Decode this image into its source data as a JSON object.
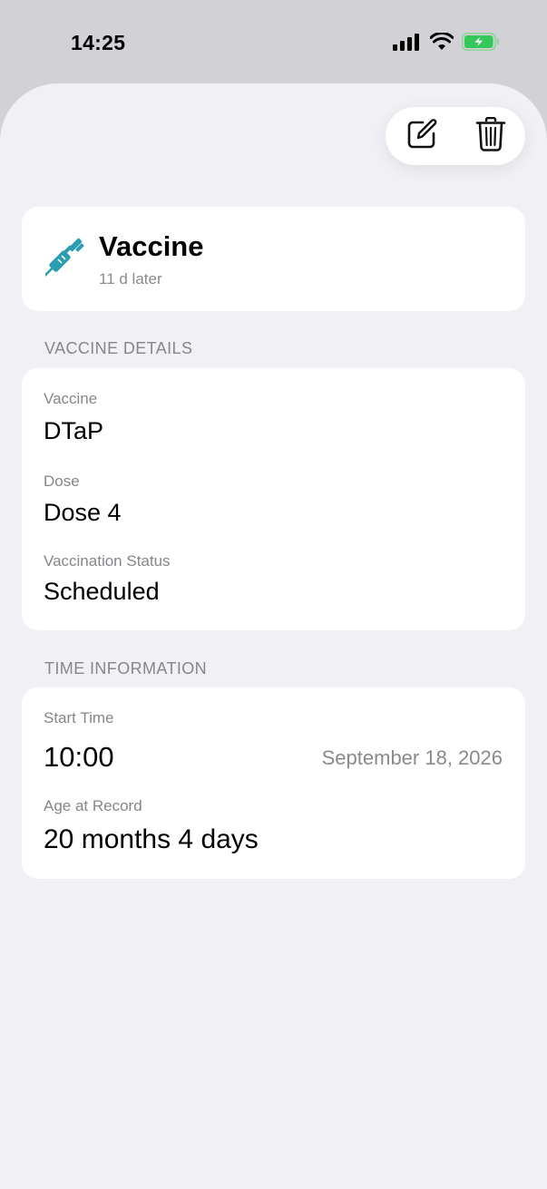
{
  "status_bar": {
    "time": "14:25",
    "icons": [
      "signal-icon",
      "wifi-icon",
      "battery-charging-icon"
    ],
    "battery_color": "#34c759"
  },
  "toolbar": {
    "edit_icon": "edit-icon",
    "delete_icon": "trash-icon"
  },
  "header": {
    "icon": "syringe-icon",
    "icon_color": "#2a9db0",
    "title": "Vaccine",
    "subtitle": "11 d later"
  },
  "vaccine_details": {
    "section_title": "VACCINE DETAILS",
    "fields": [
      {
        "label": "Vaccine",
        "value": "DTaP"
      },
      {
        "label": "Dose",
        "value": "Dose 4"
      },
      {
        "label": "Vaccination Status",
        "value": "Scheduled"
      }
    ]
  },
  "time_information": {
    "section_title": "TIME INFORMATION",
    "start_time_label": "Start Time",
    "start_time_value": "10:00",
    "start_date": "September 18, 2026",
    "age_label": "Age at Record",
    "age_value": "20 months 4 days"
  }
}
